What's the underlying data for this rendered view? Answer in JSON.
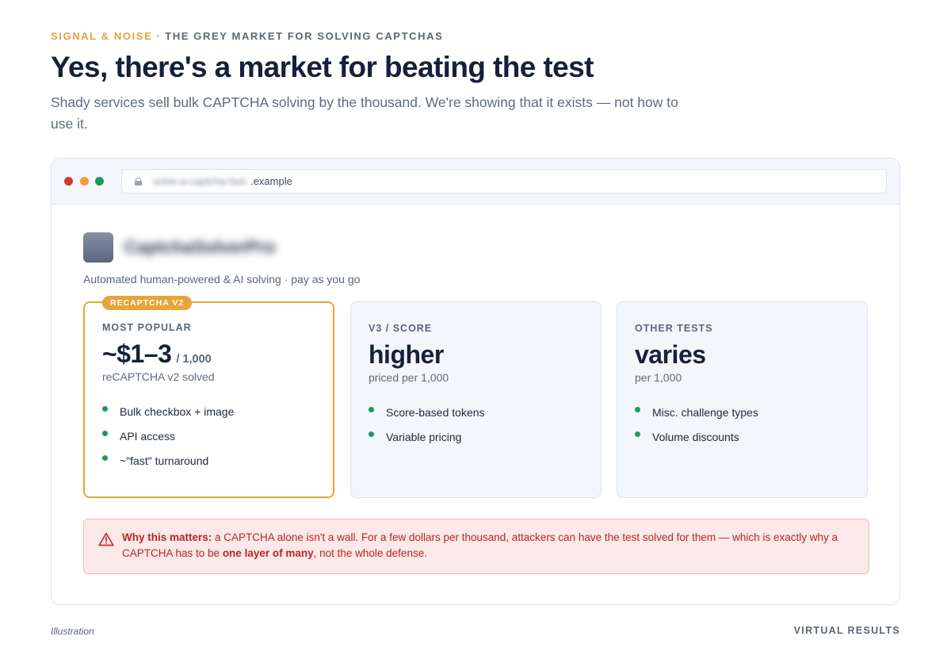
{
  "header": {
    "brand": "SIGNAL & NOISE",
    "separator": "·",
    "kicker": "THE GREY MARKET FOR SOLVING CAPTCHAS",
    "headline": "Yes, there's a market for beating the test",
    "subhead": "Shady services sell bulk CAPTCHA solving by the thousand. We're showing that it exists — not how to use it."
  },
  "browser": {
    "url_blurred": "solve-a-captcha-fast",
    "url_suffix": ".example",
    "site": {
      "name_blurred": "CaptchaSolverPro",
      "tagline": "Automated human-powered & AI solving · pay as you go"
    },
    "cards": [
      {
        "ribbon": "RECAPTCHA V2",
        "label": "MOST POPULAR",
        "price": "~$1–3",
        "unit": "/ 1,000",
        "note": "reCAPTCHA v2 solved",
        "features": [
          "Bulk checkbox + image",
          "API access",
          "~\"fast\" turnaround"
        ]
      },
      {
        "label": "V3 / SCORE",
        "price": "higher",
        "note": "priced per 1,000",
        "features": [
          "Score-based tokens",
          "Variable pricing"
        ]
      },
      {
        "label": "OTHER TESTS",
        "price": "varies",
        "note": "per 1,000",
        "features": [
          "Misc. challenge types",
          "Volume discounts"
        ]
      }
    ],
    "warning": {
      "lead": "Why this matters:",
      "text_a": " a CAPTCHA alone isn't a wall. For a few dollars per thousand, attackers can have the test solved for them — which is exactly why a CAPTCHA has to be ",
      "emphasis": "one layer of many",
      "text_b": ", not the whole defense."
    }
  },
  "footer": {
    "left": "Illustration",
    "right": "VIRTUAL RESULTS"
  },
  "colors": {
    "accent": "#e8a33b",
    "ink": "#16203a",
    "success": "#1f9a55",
    "danger": "#b52727"
  }
}
